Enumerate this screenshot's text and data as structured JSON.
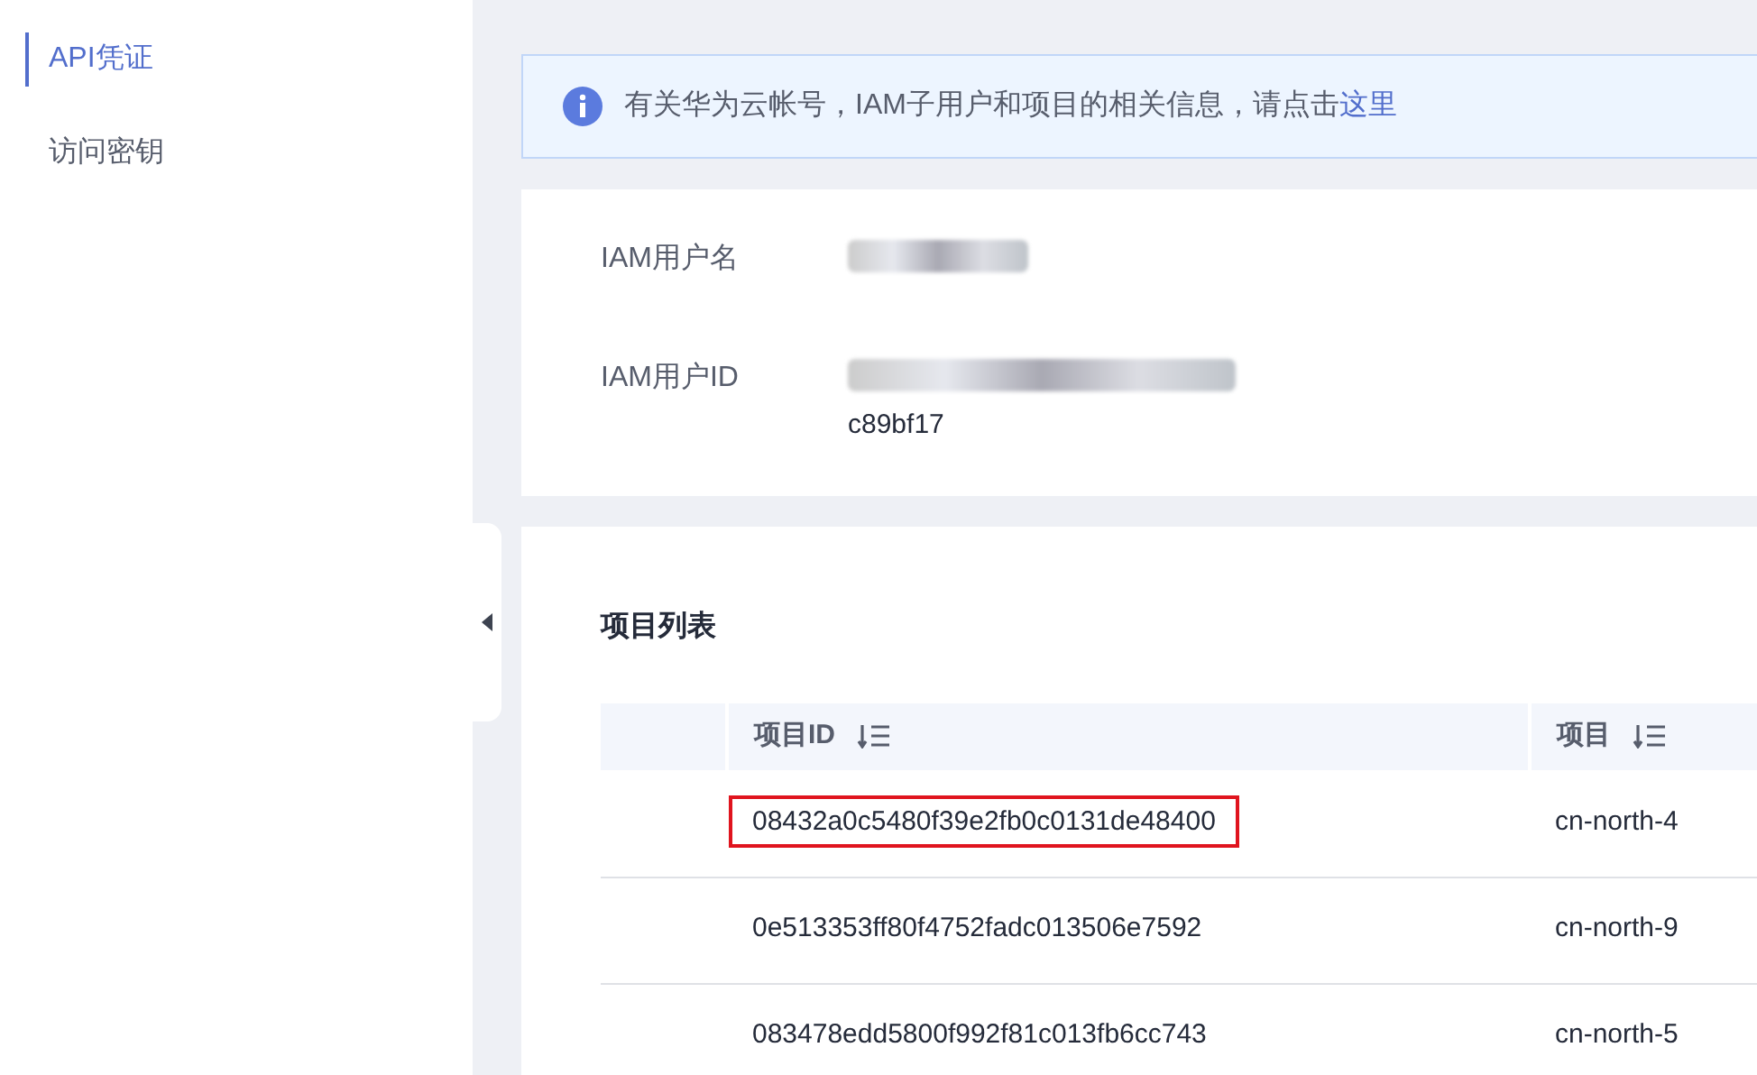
{
  "sidebar": {
    "items": [
      {
        "label": "API凭证",
        "selected": true
      },
      {
        "label": "访问密钥",
        "selected": false
      }
    ]
  },
  "alert": {
    "text": "有关华为云帐号，IAM子用户和项目的相关信息，请点击",
    "link": "这里"
  },
  "user_info": [
    {
      "label": "IAM用户名",
      "redacted": true
    },
    {
      "label": "IAM用户ID",
      "redacted": true,
      "value_tail": "c89bf17"
    }
  ],
  "projects": {
    "title": "项目列表",
    "columns": [
      "",
      "项目ID",
      "项目"
    ],
    "rows": [
      {
        "id": "08432a0c5480f39e2fb0c0131de48400",
        "project": "cn-north-4",
        "highlighted": true
      },
      {
        "id": "0e513353ff80f4752fadc013506e7592",
        "project": "cn-north-9",
        "highlighted": false
      },
      {
        "id": "083478edd5800f992f81c013fb6cc743",
        "project": "cn-north-5",
        "highlighted": false
      }
    ]
  }
}
